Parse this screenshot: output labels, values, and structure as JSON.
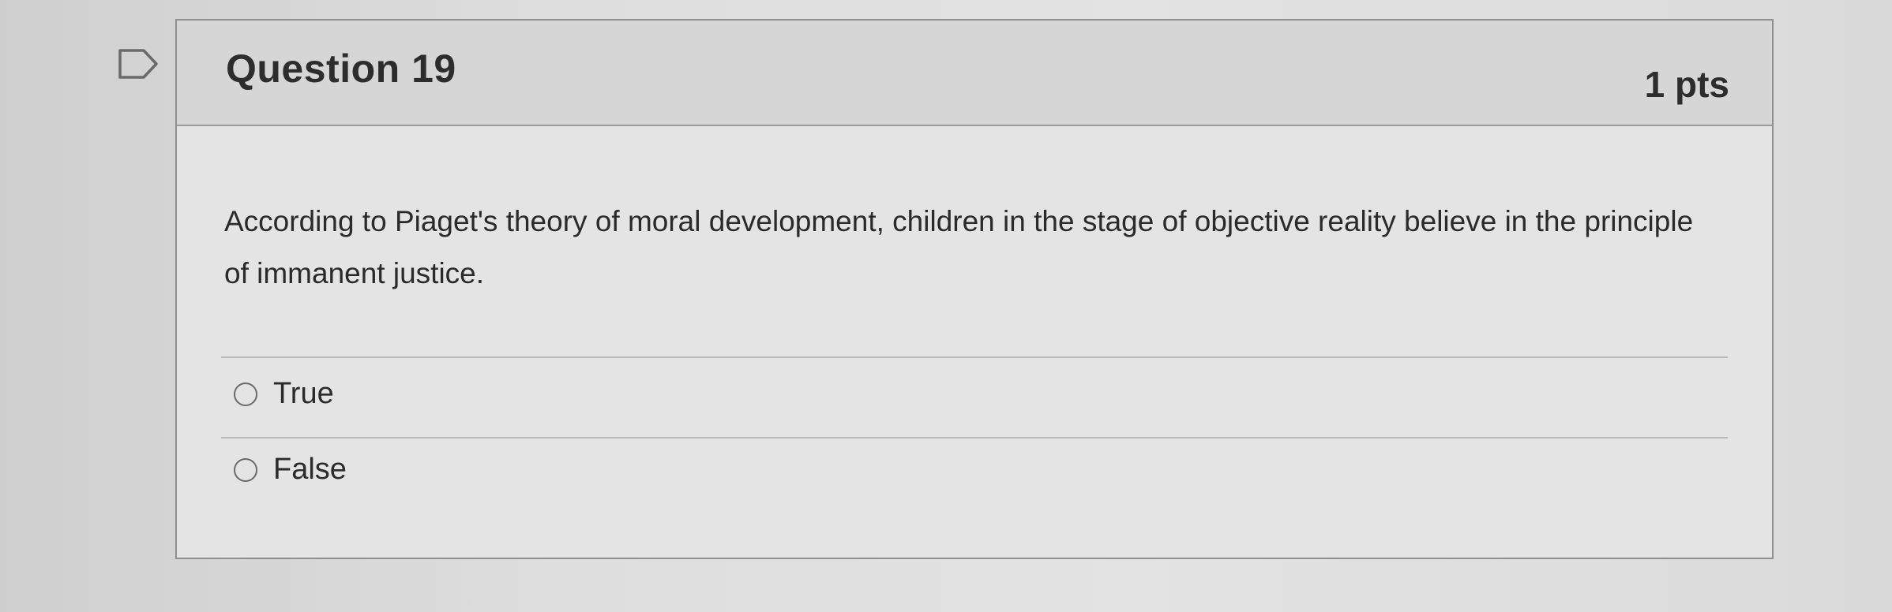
{
  "question": {
    "title": "Question 19",
    "points": "1 pts",
    "text": "According to Piaget's theory of moral development, children in the stage of objective reality believe in the principle of immanent justice."
  },
  "answers": [
    {
      "label": "True",
      "selected": false
    },
    {
      "label": "False",
      "selected": false
    }
  ],
  "icons": {
    "flag": "flag-icon",
    "radio": "radio-button-icon"
  },
  "colors": {
    "header_bg": "#d6d6d6",
    "card_bg": "#e4e4e4",
    "border": "#8f8f8f",
    "text": "#2d2d2d"
  }
}
